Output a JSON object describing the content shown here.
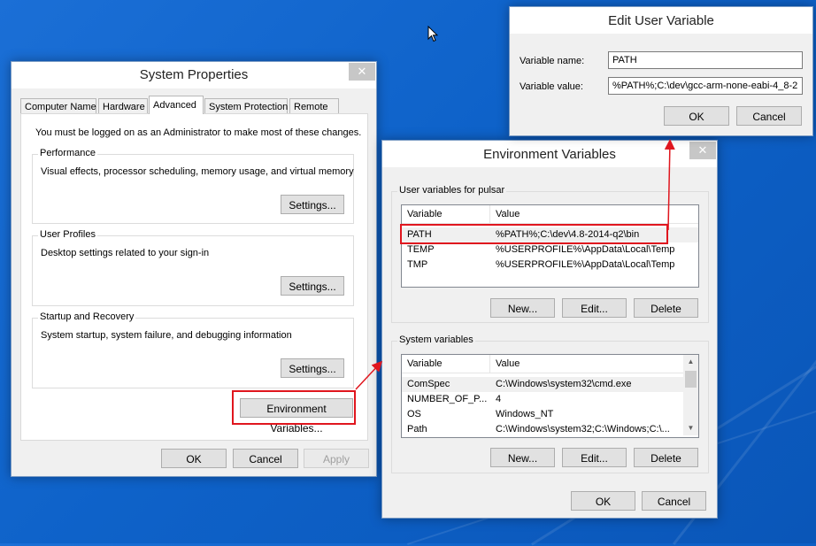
{
  "sys_props": {
    "title": "System Properties",
    "close": "✕",
    "tabs": [
      "Computer Name",
      "Hardware",
      "Advanced",
      "System Protection",
      "Remote"
    ],
    "notice": "You must be logged on as an Administrator to make most of these changes.",
    "performance": {
      "legend": "Performance",
      "desc": "Visual effects, processor scheduling, memory usage, and virtual memory",
      "button": "Settings..."
    },
    "user_profiles": {
      "legend": "User Profiles",
      "desc": "Desktop settings related to your sign-in",
      "button": "Settings..."
    },
    "startup": {
      "legend": "Startup and Recovery",
      "desc": "System startup, system failure, and debugging information",
      "button": "Settings..."
    },
    "env_button": "Environment Variables...",
    "ok": "OK",
    "cancel": "Cancel",
    "apply": "Apply"
  },
  "env_vars": {
    "title": "Environment Variables",
    "close": "✕",
    "user_group": "User variables for pulsar",
    "col_variable": "Variable",
    "col_value": "Value",
    "user_rows": [
      {
        "name": "PATH",
        "value": "%PATH%;C:\\dev\\4.8-2014-q2\\bin"
      },
      {
        "name": "TEMP",
        "value": "%USERPROFILE%\\AppData\\Local\\Temp"
      },
      {
        "name": "TMP",
        "value": "%USERPROFILE%\\AppData\\Local\\Temp"
      }
    ],
    "system_group": "System variables",
    "system_rows": [
      {
        "name": "ComSpec",
        "value": "C:\\Windows\\system32\\cmd.exe"
      },
      {
        "name": "NUMBER_OF_P...",
        "value": "4"
      },
      {
        "name": "OS",
        "value": "Windows_NT"
      },
      {
        "name": "Path",
        "value": "C:\\Windows\\system32;C:\\Windows;C:\\..."
      }
    ],
    "new": "New...",
    "edit": "Edit...",
    "delete": "Delete",
    "ok": "OK",
    "cancel": "Cancel"
  },
  "edit_var": {
    "title": "Edit User Variable",
    "name_label": "Variable name:",
    "name_value": "PATH",
    "value_label": "Variable value:",
    "value_value": "%PATH%;C:\\dev\\gcc-arm-none-eabi-4_8-2",
    "ok": "OK",
    "cancel": "Cancel"
  },
  "colors": {
    "highlight": "#e0161e",
    "desktop": "#0e62c9"
  }
}
